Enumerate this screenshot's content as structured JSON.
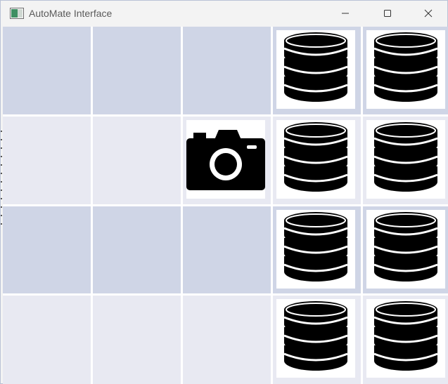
{
  "window": {
    "title": "AutoMate Interface",
    "controls": [
      "minimize",
      "maximize",
      "close"
    ]
  },
  "grid": {
    "rows": 4,
    "columns": 5,
    "row_colors": [
      "#cfd5e6",
      "#e8e9f2",
      "#cfd5e6",
      "#e8e9f2"
    ],
    "cells": [
      [
        "empty",
        "empty",
        "empty",
        "database-icon",
        "database-icon"
      ],
      [
        "empty",
        "empty",
        "camera-icon",
        "database-icon",
        "database-icon"
      ],
      [
        "empty",
        "empty",
        "empty",
        "database-icon",
        "database-icon"
      ],
      [
        "empty",
        "empty",
        "empty",
        "database-icon",
        "database-icon"
      ]
    ]
  }
}
